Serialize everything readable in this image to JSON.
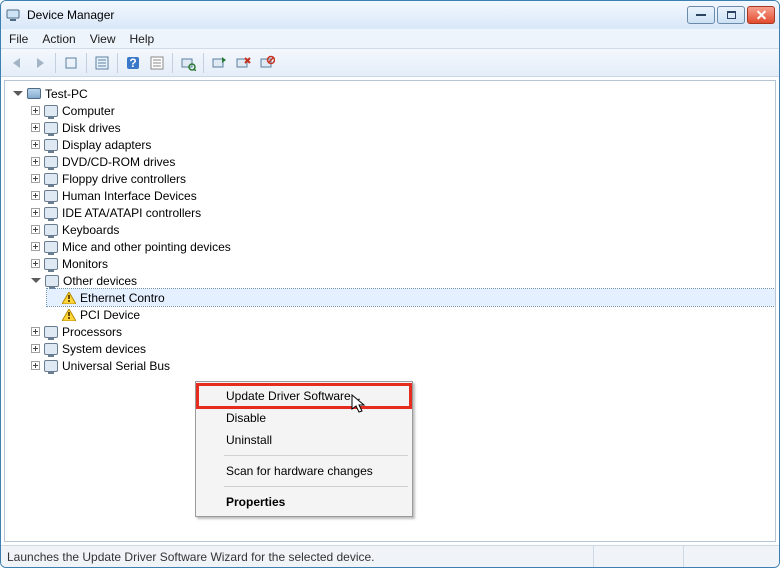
{
  "window": {
    "title": "Device Manager"
  },
  "menu": {
    "file": "File",
    "action": "Action",
    "view": "View",
    "help": "Help"
  },
  "tree": {
    "root": "Test-PC",
    "nodes": [
      "Computer",
      "Disk drives",
      "Display adapters",
      "DVD/CD-ROM drives",
      "Floppy drive controllers",
      "Human Interface Devices",
      "IDE ATA/ATAPI controllers",
      "Keyboards",
      "Mice and other pointing devices",
      "Monitors"
    ],
    "other_devices_label": "Other devices",
    "other_children": {
      "ethernet": "Ethernet Contro",
      "pci": "PCI Device"
    },
    "tail": [
      "Processors",
      "System devices",
      "Universal Serial Bus"
    ]
  },
  "ctx": {
    "update": "Update Driver Software...",
    "disable": "Disable",
    "uninstall": "Uninstall",
    "scan": "Scan for hardware changes",
    "properties": "Properties"
  },
  "status": {
    "text": "Launches the Update Driver Software Wizard for the selected device."
  }
}
